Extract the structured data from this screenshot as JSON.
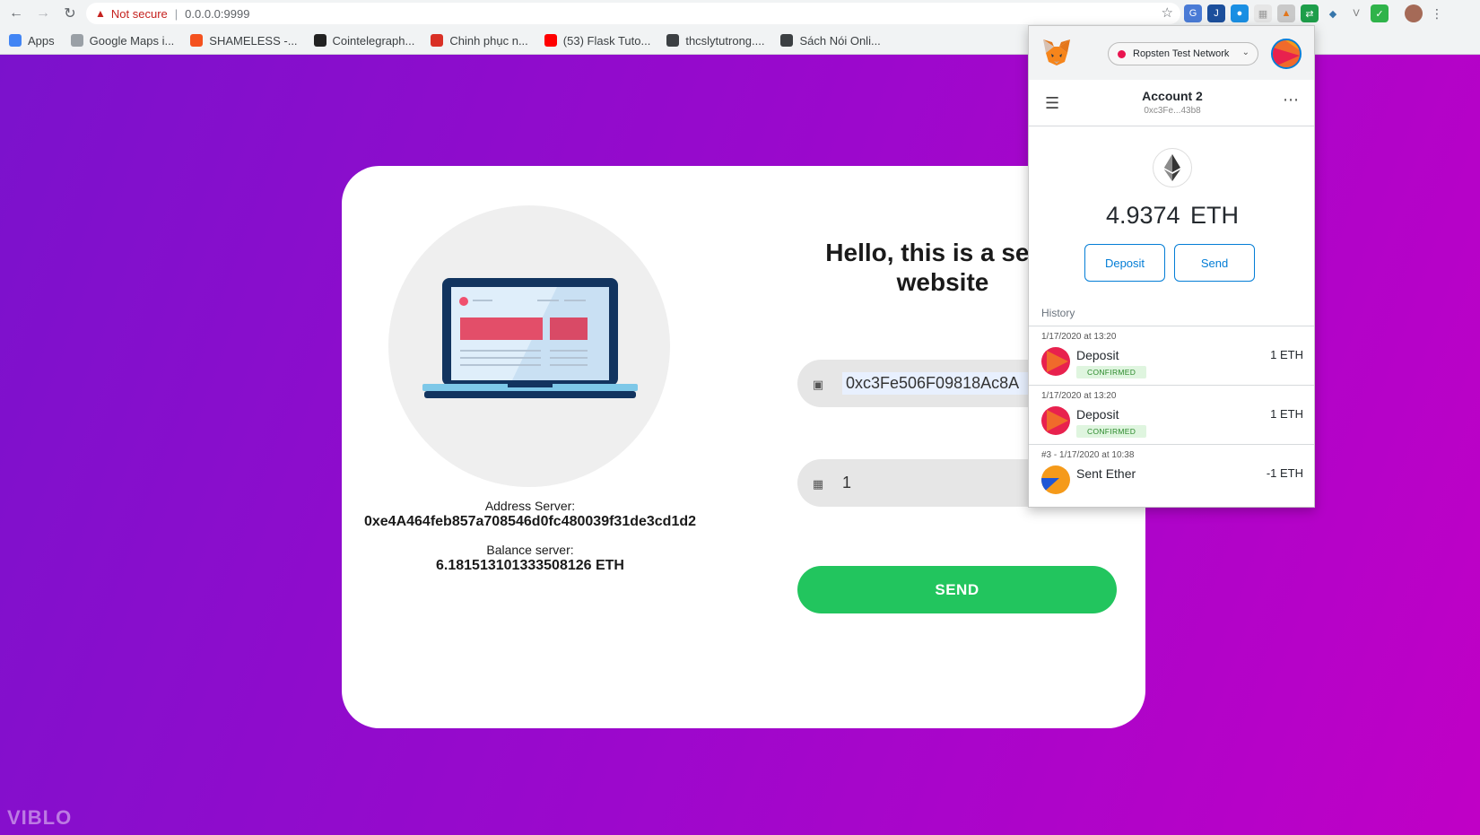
{
  "browser": {
    "not_secure": "Not secure",
    "url": "0.0.0.0:9999",
    "bookmarks": [
      {
        "label": "Apps",
        "color": "#4285f4"
      },
      {
        "label": "Google Maps i...",
        "color": "#9aa0a6"
      },
      {
        "label": "SHAMELESS -...",
        "color": "#f4511e"
      },
      {
        "label": "Cointelegraph...",
        "color": "#222222"
      },
      {
        "label": "Chinh phục n...",
        "color": "#d93025"
      },
      {
        "label": "(53) Flask Tuto...",
        "color": "#ff0000"
      },
      {
        "label": "thcslytutrong....",
        "color": "#3c4043"
      },
      {
        "label": "Sách Nói Onli...",
        "color": "#3c4043"
      }
    ]
  },
  "page": {
    "title_line1": "Hello, this is a send",
    "title_line2": "website",
    "address_server_label": "Address Server:",
    "address_server_value": "0xe4A464feb857a708546d0fc480039f31de3cd1d2",
    "balance_server_label": "Balance server:",
    "balance_server_value": "6.181513101333508126 ETH",
    "address_input_value": "0xc3Fe506F09818Ac8A",
    "amount_input_value": "1",
    "send_button": "SEND",
    "watermark": "VIBLO"
  },
  "metamask": {
    "network": "Ropsten Test Network",
    "account_name": "Account 2",
    "account_short": "0xc3Fe...43b8",
    "balance": "4.9374",
    "currency": "ETH",
    "deposit_button": "Deposit",
    "send_button": "Send",
    "history_label": "History",
    "transactions": [
      {
        "date": "1/17/2020 at 13:20",
        "title": "Deposit",
        "status": "CONFIRMED",
        "amount": "1 ETH"
      },
      {
        "date": "1/17/2020 at 13:20",
        "title": "Deposit",
        "status": "CONFIRMED",
        "amount": "1 ETH"
      },
      {
        "date": "#3 - 1/17/2020 at 10:38",
        "title": "Sent Ether",
        "status": "",
        "amount": "-1 ETH"
      }
    ]
  }
}
